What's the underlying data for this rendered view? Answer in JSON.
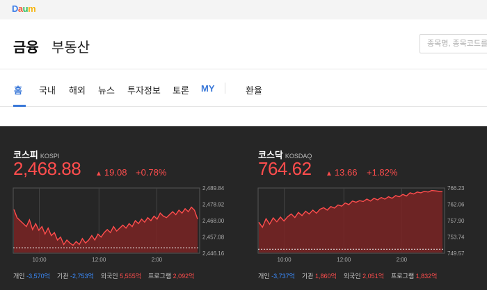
{
  "logo": {
    "text": "Daum",
    "letters": [
      "D",
      "a",
      "u",
      "m"
    ],
    "colors": [
      "#3b7de8",
      "#f15a3b",
      "#2dbe60",
      "#f6b40e"
    ]
  },
  "header": {
    "title": "금융",
    "subtitle": "부동산",
    "search_placeholder": "종목명, 종목코드를 입"
  },
  "nav": {
    "items": [
      {
        "label": "홈",
        "active": true
      },
      {
        "label": "국내"
      },
      {
        "label": "해외"
      },
      {
        "label": "뉴스"
      },
      {
        "label": "투자정보"
      },
      {
        "label": "토론"
      },
      {
        "label": "MY"
      },
      {
        "label": "환율"
      }
    ]
  },
  "colors": {
    "up": "#ff4d4d",
    "down": "#3b8cff",
    "accent": "#3a78d8",
    "market_bg": "#262626"
  },
  "kospi": {
    "name": "코스피",
    "code": "KOSPI",
    "price": "2,468.88",
    "change": "19.08",
    "change_icon": "up-triangle-icon",
    "pct": "+0.78%",
    "yticks": [
      "2,489.84",
      "2,478.92",
      "2,468.00",
      "2,457.08",
      "2,446.16"
    ],
    "xticks": [
      "10:00",
      "12:00",
      "2:00"
    ],
    "investors": {
      "individual_label": "개인",
      "individual": "-3,570억",
      "inst_label": "기관",
      "inst": "-2,753억",
      "foreign_label": "외국인",
      "foreign": "5,555억",
      "program_label": "프로그램",
      "program": "2,092억"
    }
  },
  "kosdaq": {
    "name": "코스닥",
    "code": "KOSDAQ",
    "price": "764.62",
    "change": "13.66",
    "change_icon": "up-triangle-icon",
    "pct": "+1.82%",
    "yticks": [
      "766.23",
      "762.06",
      "757.90",
      "753.74",
      "749.57"
    ],
    "xticks": [
      "10:00",
      "12:00",
      "2:00"
    ],
    "investors": {
      "individual_label": "개인",
      "individual": "-3,737억",
      "inst_label": "기관",
      "inst": "1,860억",
      "foreign_label": "외국인",
      "foreign": "2,051억",
      "program_label": "프로그램",
      "program": "1,832억"
    }
  },
  "chart_data": [
    {
      "type": "area",
      "title": "KOSPI",
      "ylim": [
        2446.16,
        2489.84
      ],
      "baseline": 2449.8,
      "x_ticks": [
        "10:00",
        "12:00",
        "2:00"
      ],
      "y": [
        2475.5,
        2470,
        2468,
        2466,
        2464,
        2468.5,
        2462,
        2466,
        2461.5,
        2464,
        2459,
        2463,
        2458,
        2460,
        2455,
        2457,
        2452,
        2455,
        2453,
        2451.5,
        2454,
        2452,
        2456,
        2453,
        2455,
        2458,
        2455,
        2459,
        2457,
        2460,
        2462,
        2460,
        2464,
        2461,
        2463,
        2465,
        2463,
        2466,
        2464,
        2468,
        2466,
        2469,
        2467,
        2470,
        2468,
        2471,
        2469,
        2473,
        2471,
        2470,
        2472,
        2474,
        2472,
        2475,
        2473,
        2476,
        2474,
        2477,
        2475,
        2469
      ]
    },
    {
      "type": "area",
      "title": "KOSDAQ",
      "ylim": [
        749.57,
        766.23
      ],
      "baseline": 750.6,
      "x_ticks": [
        "10:00",
        "12:00",
        "2:00"
      ],
      "y": [
        757.5,
        756.2,
        758.4,
        757.0,
        758.6,
        757.6,
        758.8,
        757.8,
        758.9,
        759.6,
        758.7,
        760.0,
        759.2,
        760.3,
        759.6,
        760.6,
        759.8,
        760.8,
        761.2,
        760.6,
        761.5,
        761.1,
        761.9,
        761.6,
        762.4,
        762.0,
        762.9,
        762.6,
        763.0,
        762.8,
        763.4,
        762.9,
        763.6,
        763.2,
        763.8,
        763.4,
        764.0,
        763.6,
        764.3,
        764.0,
        764.6,
        764.2,
        765.0,
        764.7,
        765.2,
        765.0,
        765.4,
        765.2,
        765.6,
        765.5,
        765.4,
        765.3
      ]
    }
  ]
}
